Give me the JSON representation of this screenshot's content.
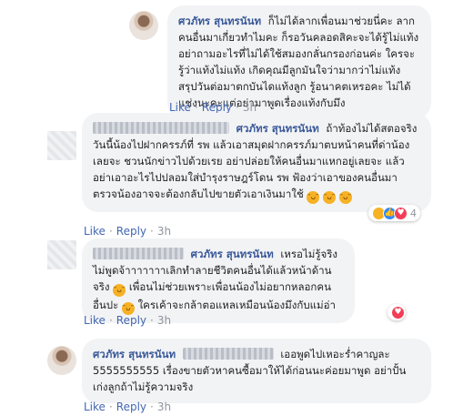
{
  "comments": [
    {
      "author": "ศวภัทร สุนทรนันท",
      "text": "ก็ไม่ได้ลากเพื่อนมาช่วยนี่คะ ลากคนอื่นมาเกี่ยวทำไมคะ ก็รอวันคลอดสิคะจะได้รู้ไม่แท้ง อย่าถามอะไรที่ไม่ได้ใช้สมองกลั่นกรองก่อนค่ะ ใครจะรู้ว่าแท้งไม่แท้ง เกิดคุณมีลูกมันใจว่ามากว่าไม่แท้ง สรุปวันต่อมาตกบันไดแท้งลูก รู้อนาคตเหรอคะ ไม่ได้แช่งนะคะแต่อย่ามาพูดเรื่องแท้งกับมึง",
      "like": "Like",
      "reply": "Reply",
      "time": "3h",
      "dot": "·"
    },
    {
      "author": "ศวภัทร สุนทรนันท",
      "text_before": "ถ้าท้องไม่ได้สตอจริงวันนี้น้องไปฝากครรภ์ที่ รพ แล้วเอาสมุดฝากครรภ์มาตบหน้าคนที่ด่าน้องเลยจะ ชวนนักข่าวไปด้วยเรย อย่าปล่อยให้คนอื่นมาแหกอยู่เลยจะ แล้วอย่าเอาอะไรไปปลอมใส่บำรุงราษฎร์โดน รพ ฟ้องว่าเอาของคนอื่นมาตรวจน้องอาจจะต้องกลับไปขายตัวเอาเงินมาใช้",
      "emojis": [
        "haha",
        "haha",
        "haha"
      ],
      "like": "Like",
      "reply": "Reply",
      "time": "3h",
      "dot": "·",
      "reaction_count": "4",
      "reactions": [
        "haha",
        "like",
        "love"
      ]
    },
    {
      "author": "ศวภัทร สุนทรนันท",
      "text_part1": "เหรอไม่รู้จริงไม่พูดจ้าาาาาาาเลิกทำลายชีวิตคนอื่นได้แล้วหน้าด้านจริง",
      "text_part2": " เพื่อนไม่ช่วยเพราะเพื่อนน้องไม่อยากหลอกคนอื่นปะ",
      "text_part3": " ใครเค้าจะกล้าตอแหลเหมือนน้องมึงกับแม่อ่า",
      "like": "Like",
      "reply": "Reply",
      "time": "3h",
      "dot": "·",
      "reactions": [
        "love"
      ]
    },
    {
      "author": "ศวภัทร สุนทรนันท",
      "text": "เออพูดไปเหอะร่ำคาญละ 5555555555 เรื่องขายตัวหาคนซื้อมาให้ได้ก่อนนะค่อยมาพูด อย่าปั้นเก่งลูกถ้าไม่รู้ความจริง",
      "like": "Like",
      "reply": "Reply",
      "time": "3h",
      "dot": "·"
    }
  ],
  "colors": {
    "author": "#385898",
    "link": "#4267b2",
    "meta": "#90949c",
    "bubble": "#f2f3f5"
  }
}
